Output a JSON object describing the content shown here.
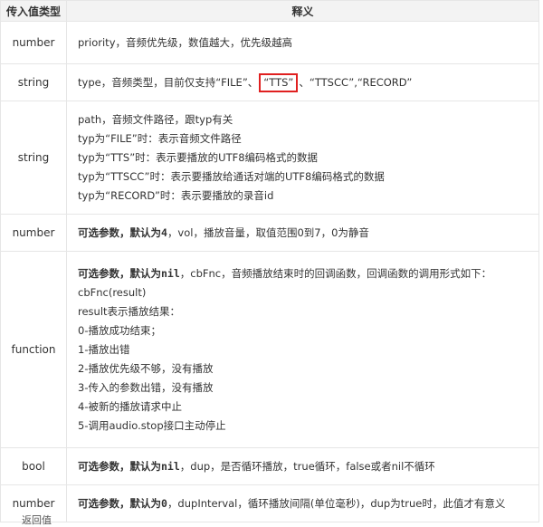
{
  "header": {
    "col1": "传入值类型",
    "col2": "释义"
  },
  "rows": [
    {
      "type": "number",
      "lines": [
        "priority，音频优先级，数值越大，优先级越高"
      ]
    },
    {
      "type": "string",
      "pre": "type，音频类型，目前仅支持“FILE”、",
      "highlight": "“TTS”",
      "post": "、“TTSCC”,“RECORD”"
    },
    {
      "type": "string",
      "lines": [
        "path，音频文件路径，跟typ有关",
        "typ为“FILE”时：表示音频文件路径",
        "typ为“TTS”时：表示要播放的UTF8编码格式的数据",
        "typ为“TTSCC”时：表示要播放给通话对端的UTF8编码格式的数据",
        "typ为“RECORD”时：表示要播放的录音id"
      ]
    },
    {
      "type": "number",
      "bold": "可选参数，默认为",
      "code": "4",
      "rest": "，vol，播放音量，取值范围0到7，0为静音"
    },
    {
      "type": "function",
      "bold": "可选参数，默认为",
      "code": "nil",
      "rest": "，cbFnc，音频播放结束时的回调函数，回调函数的调用形式如下：",
      "lines": [
        "cbFnc(result)",
        "result表示播放结果：",
        "0-播放成功结束；",
        "1-播放出错",
        "2-播放优先级不够，没有播放",
        "3-传入的参数出错，没有播放",
        "4-被新的播放请求中止",
        "5-调用audio.stop接口主动停止"
      ]
    },
    {
      "type": "bool",
      "bold": "可选参数，默认为",
      "code": "nil",
      "rest": "，dup，是否循环播放，true循环，false或者nil不循环"
    },
    {
      "type": "number",
      "bold": "可选参数，默认为",
      "code": "0",
      "rest": "，dupInterval，循环播放间隔(单位毫秒)，dup为true时，此值才有意义"
    }
  ],
  "footer": "返回值"
}
